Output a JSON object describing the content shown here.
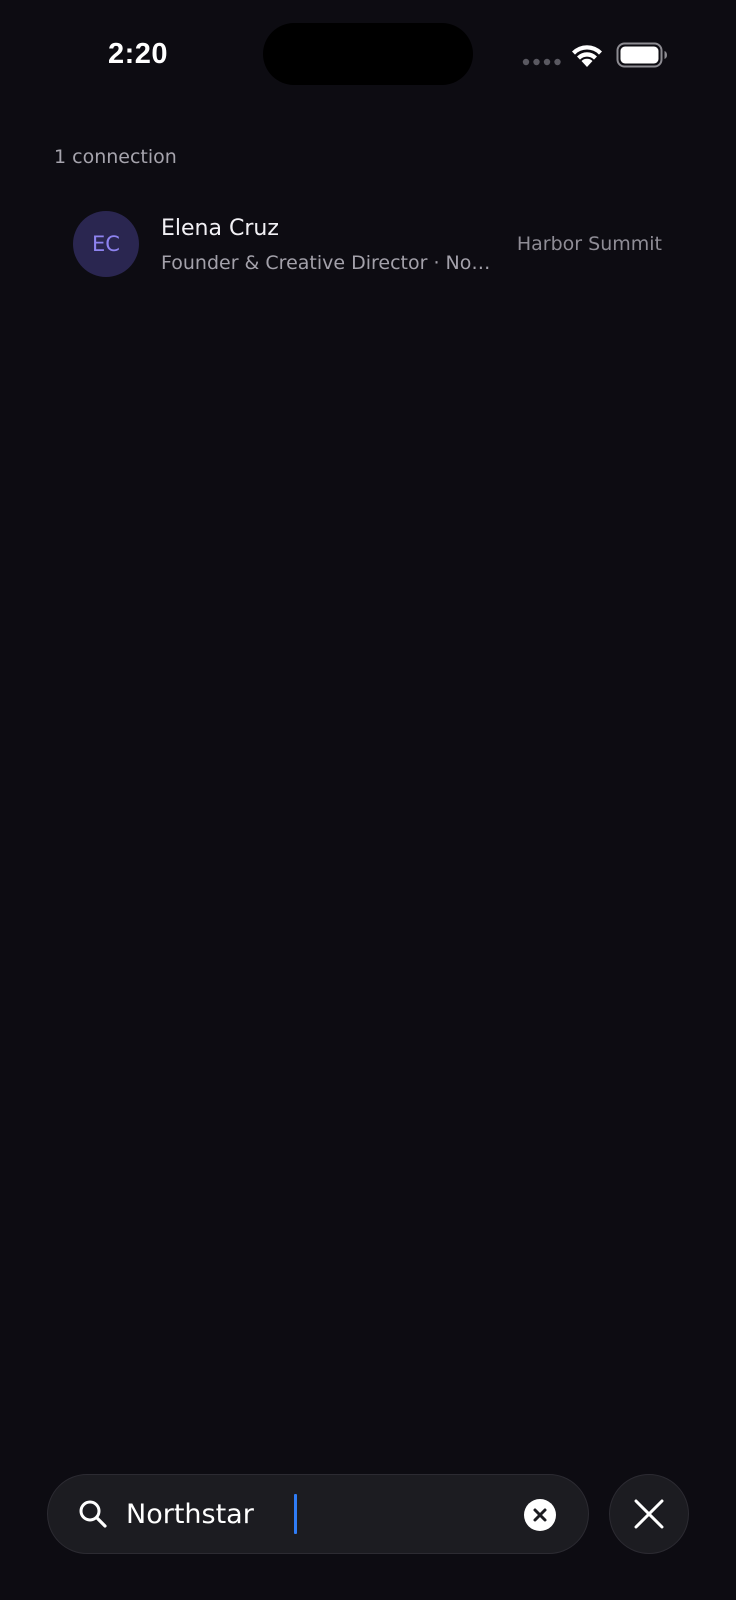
{
  "status_bar": {
    "time": "2:20",
    "icons": [
      "cellular-dots-icon",
      "wifi-icon",
      "battery-icon"
    ]
  },
  "results": {
    "count_label": "1 connection",
    "connections": [
      {
        "initials": "EC",
        "name": "Elena Cruz",
        "subtitle": "Founder & Creative Director · Northstar",
        "event": "Harbor Summit"
      }
    ]
  },
  "search": {
    "value": "Northstar",
    "icon": "search-icon",
    "clear_icon": "clear-icon",
    "close_icon": "close-icon"
  },
  "colors": {
    "background": "#0d0c12",
    "avatar_bg": "#2a2650",
    "avatar_text": "#8e83f0",
    "caret": "#2f7cf6"
  }
}
